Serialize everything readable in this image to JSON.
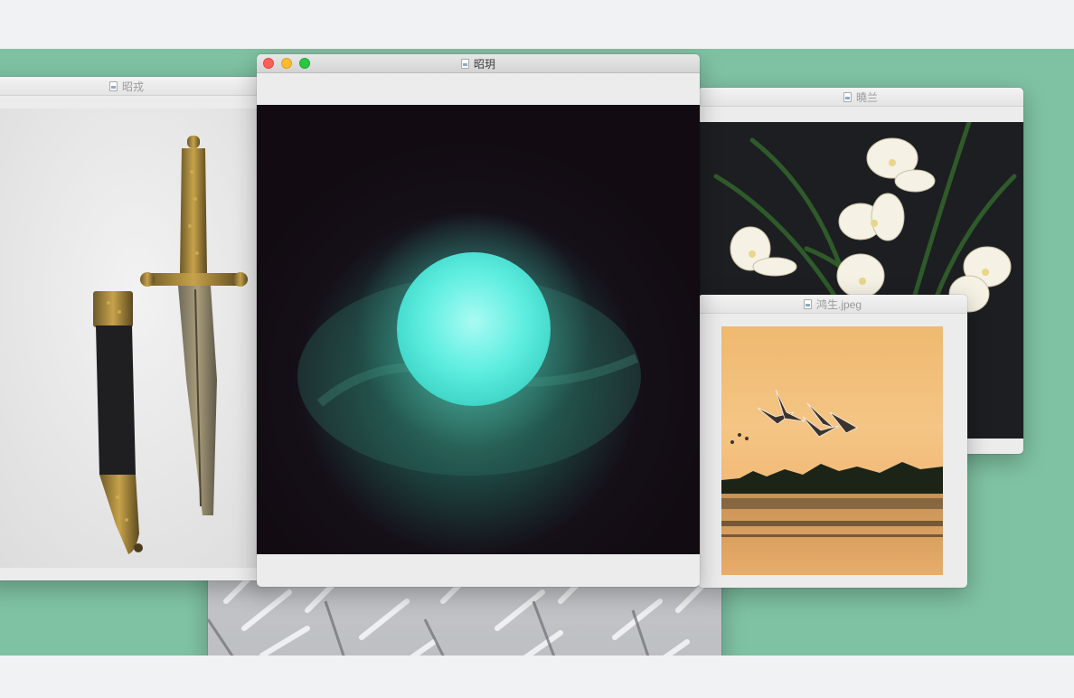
{
  "windows": {
    "dagger": {
      "title": "昭戎",
      "icon": "image-file-icon"
    },
    "orb": {
      "title": "昭玥",
      "icon": "image-file-icon"
    },
    "orchid": {
      "title": "曉兰",
      "icon": "image-file-icon"
    },
    "geese": {
      "title": "鸿生.jpeg",
      "icon": "image-file-icon"
    },
    "frost": {
      "title": "",
      "icon": "image-file-icon"
    }
  },
  "colors": {
    "desktop": "#7fc2a3",
    "page": "#f1f2f4",
    "window": "#ececec",
    "close": "#fc5f57",
    "minimize": "#fdbc2e",
    "maximize": "#29c840"
  }
}
